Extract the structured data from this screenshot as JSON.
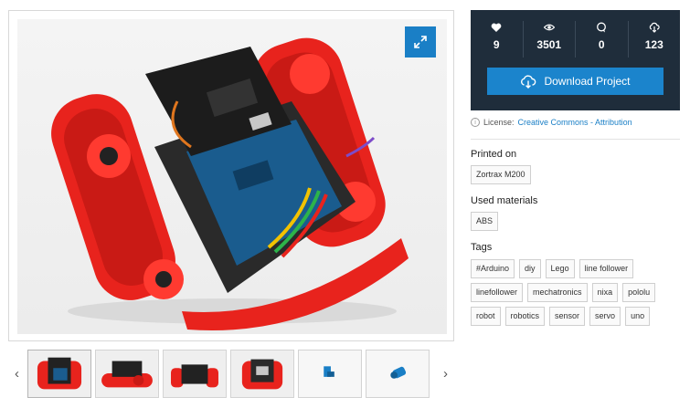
{
  "stats": {
    "likes": "9",
    "views": "3501",
    "comments": "0",
    "downloads": "123"
  },
  "download_label": "Download Project",
  "license": {
    "prefix": "License:",
    "link": "Creative Commons - Attribution"
  },
  "printed_on": {
    "title": "Printed on",
    "value": "Zortrax M200"
  },
  "materials": {
    "title": "Used materials",
    "value": "ABS"
  },
  "tags": {
    "title": "Tags",
    "items": [
      "#Arduino",
      "diy",
      "Lego",
      "line follower",
      "linefollower",
      "mechatronics",
      "nixa",
      "pololu",
      "robot",
      "robotics",
      "sensor",
      "servo",
      "uno"
    ]
  },
  "icons": [
    "heart-icon",
    "eye-icon",
    "comment-icon",
    "cloud-download-icon",
    "expand-icon",
    "chevron-left-icon",
    "chevron-right-icon",
    "info-icon"
  ],
  "colors": {
    "accent": "#1b84cc",
    "stats_bg": "#1f2d3b",
    "robot_red": "#e8231d"
  }
}
